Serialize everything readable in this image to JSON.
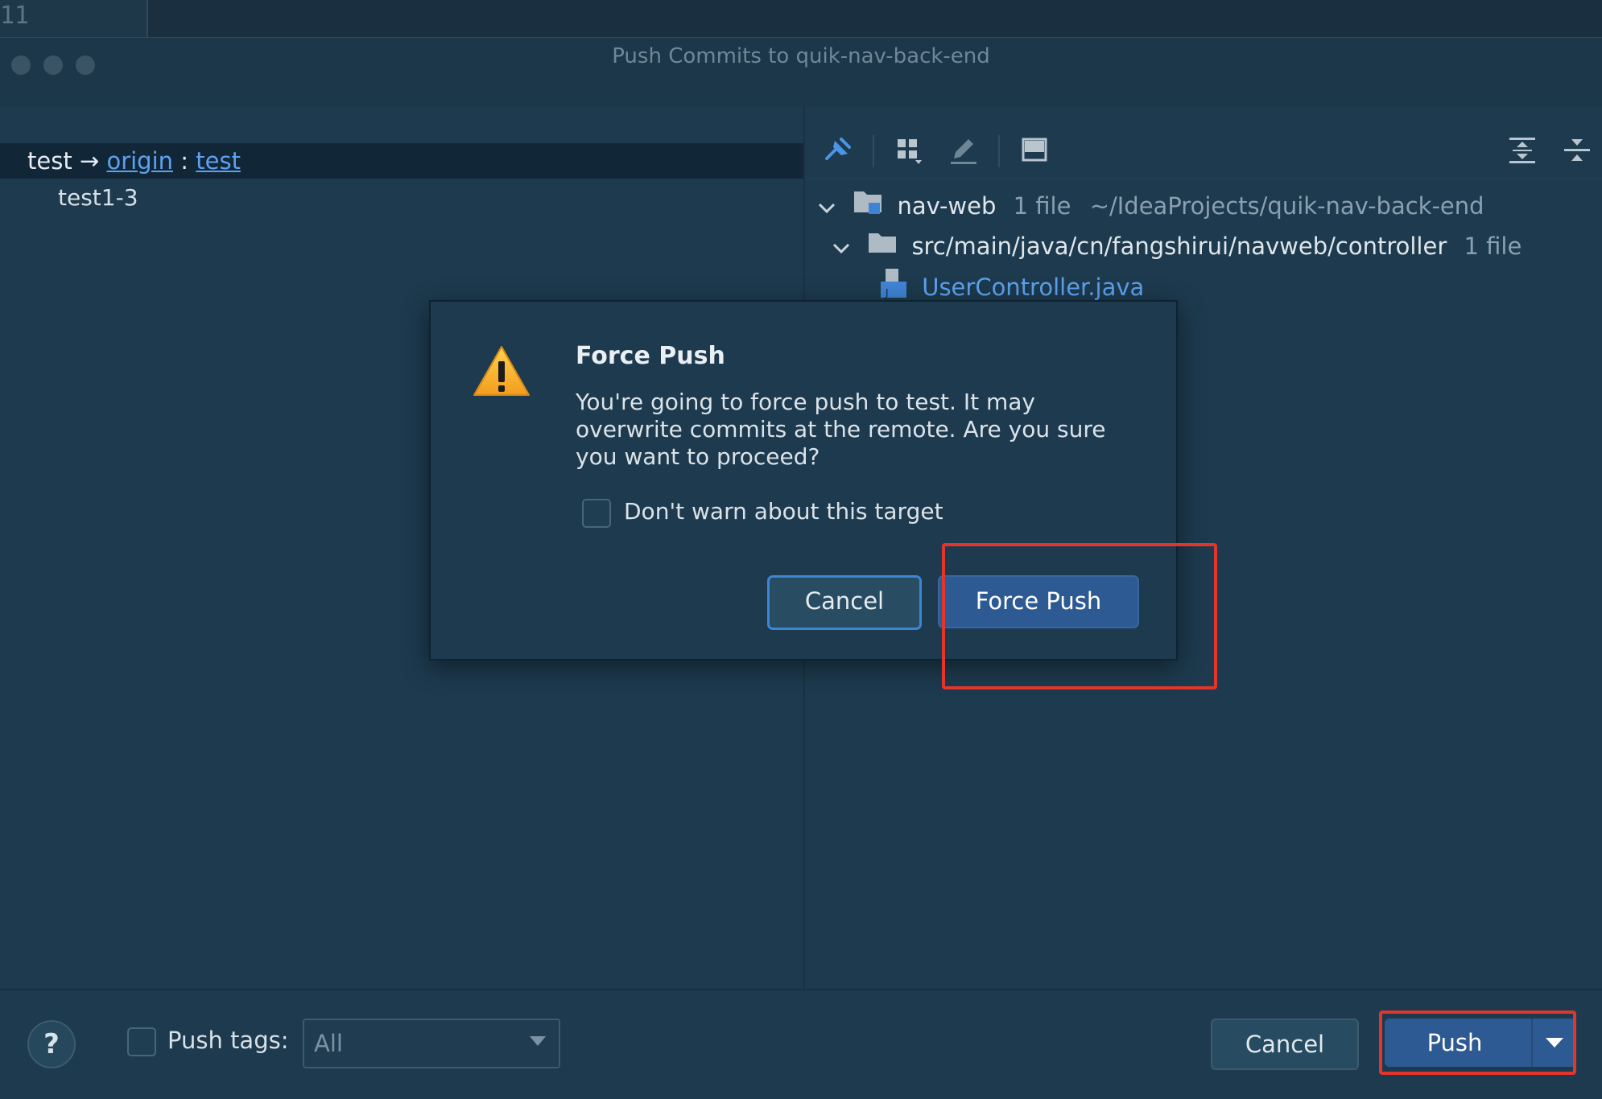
{
  "editor": {
    "line_number": "11"
  },
  "window": {
    "title": "Push Commits to quik-nav-back-end"
  },
  "left_panel": {
    "branch": {
      "local": "test",
      "arrow": "→",
      "remote": "origin",
      "separator": ":",
      "remote_branch": "test"
    },
    "commits": [
      "test1-3"
    ]
  },
  "right_panel": {
    "toolbar_icons": [
      "pin-icon",
      "group-by-icon",
      "edit-icon",
      "preview-icon",
      "expand-all-icon",
      "collapse-all-icon"
    ],
    "tree": {
      "root": {
        "name": "nav-web",
        "count": "1 file",
        "path": "~/IdeaProjects/quik-nav-back-end"
      },
      "folder": {
        "name": "src/main/java/cn/fangshirui/navweb/controller",
        "count": "1 file"
      },
      "file": {
        "name": "UserController.java"
      }
    }
  },
  "bottom_bar": {
    "help_label": "?",
    "push_tags_label": "Push tags:",
    "push_tags_value": "All",
    "cancel_label": "Cancel",
    "push_label": "Push"
  },
  "modal": {
    "title": "Force Push",
    "message": "You're going to force push to test. It may overwrite commits at the remote. Are you sure you want to proceed?",
    "checkbox_label": "Don't warn about this target",
    "cancel_label": "Cancel",
    "force_label": "Force Push"
  },
  "colors": {
    "accent": "#2d5a93",
    "link": "#5ea1ef",
    "highlight": "#e3352b",
    "warning": "#f5b731"
  }
}
